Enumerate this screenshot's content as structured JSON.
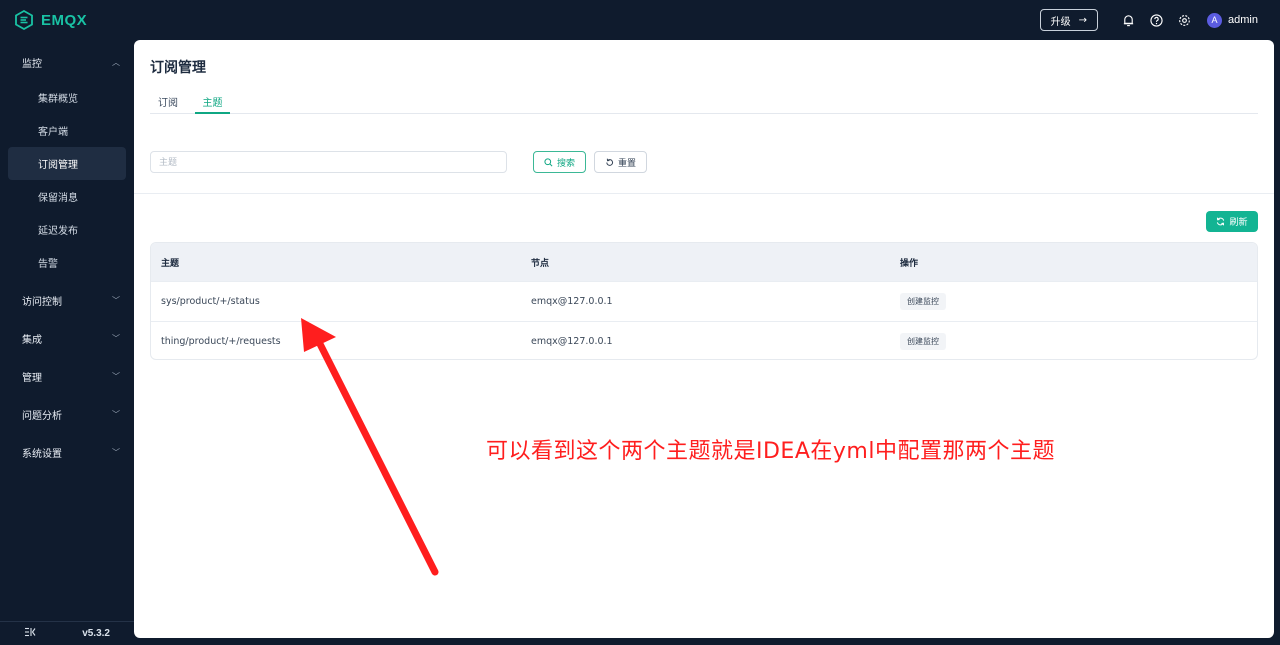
{
  "app": {
    "brand": "EMQX",
    "upgrade_label": "升级",
    "username": "admin",
    "avatar_letter": "A",
    "version": "v5.3.2",
    "accent_color": "#19c2a4"
  },
  "sidebar": {
    "groups": [
      {
        "label": "监控",
        "expanded": true,
        "items": [
          "集群概览",
          "客户端",
          "订阅管理",
          "保留消息",
          "延迟发布",
          "告警"
        ]
      },
      {
        "label": "访问控制"
      },
      {
        "label": "集成"
      },
      {
        "label": "管理"
      },
      {
        "label": "问题分析"
      },
      {
        "label": "系统设置"
      }
    ],
    "active_item": "订阅管理"
  },
  "page": {
    "title": "订阅管理",
    "tabs": [
      "订阅",
      "主题"
    ],
    "active_tab": "主题",
    "search": {
      "placeholder": "主题",
      "search_label": "搜索",
      "reset_label": "重置"
    },
    "refresh_label": "刷新",
    "table": {
      "headers": [
        "主题",
        "节点",
        "操作"
      ],
      "rows": [
        {
          "topic": "sys/product/+/status",
          "node": "emqx@127.0.0.1",
          "action": "创建监控"
        },
        {
          "topic": "thing/product/+/requests",
          "node": "emqx@127.0.0.1",
          "action": "创建监控"
        }
      ]
    }
  },
  "annotation": {
    "text": "可以看到这个两个主题就是IDEA在yml中配置那两个主题",
    "color": "#ff1e1e"
  }
}
